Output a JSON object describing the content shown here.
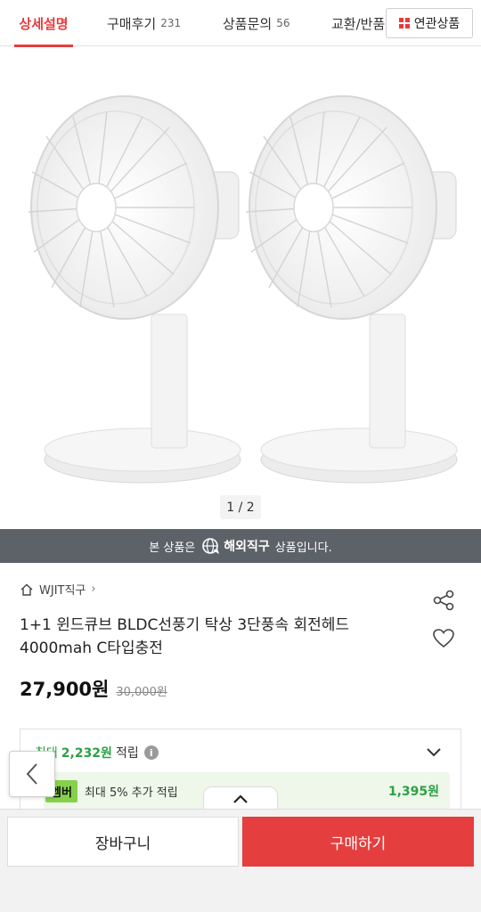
{
  "tabs": {
    "detail": "상세설명",
    "review": "구매후기",
    "review_count": "231",
    "qna": "상품문의",
    "qna_count": "56",
    "exchange": "교환/반품",
    "related": "연관상품"
  },
  "gallery": {
    "pager": "1 / 2"
  },
  "banner": {
    "prefix": "본 상품은",
    "highlight": "해외직구",
    "suffix": "상품입니다."
  },
  "product": {
    "seller": "WJIT직구",
    "title": "1+1 윈드큐브 BLDC선풍기 탁상 3단풍속 회전헤드 4000mah C타입충전",
    "price": "27,900원",
    "original_price": "30,000원"
  },
  "points": {
    "max_label": "최대",
    "max_amount": "2,232원",
    "earn_label": "적립",
    "member_badge": "멤버",
    "member_text": "최대 5% 추가 적립",
    "member_amount": "1,395원"
  },
  "actions": {
    "cart": "장바구니",
    "buy": "구매하기"
  },
  "colors": {
    "accent": "#e73c3c",
    "banner_bg": "#5d6168",
    "green": "#2aa144"
  }
}
